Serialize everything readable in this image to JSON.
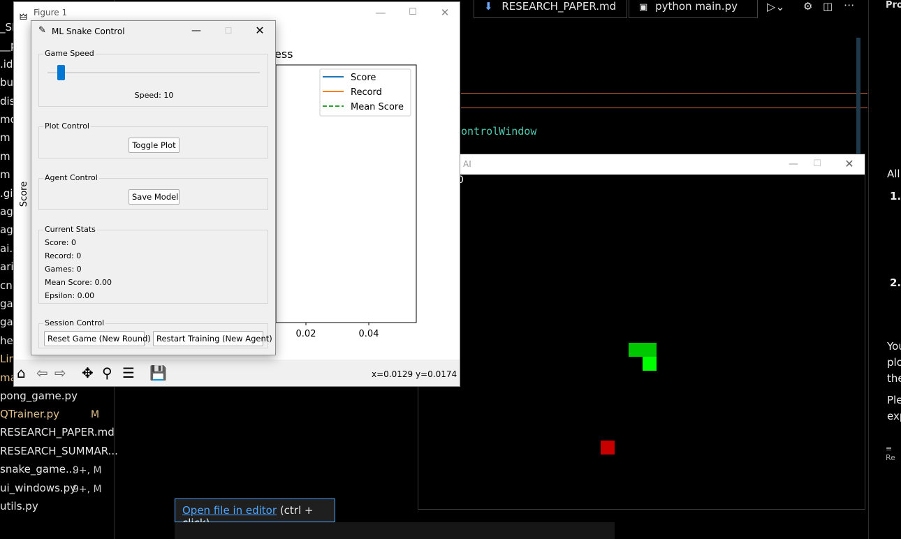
{
  "explorer": {
    "partial_items": [
      "_SN",
      "__p",
      ".ide",
      "bu",
      "dis",
      "mo",
      "m",
      "m",
      "m",
      ".git",
      "age",
      "age",
      "ai.i",
      "aria",
      "cnn",
      "ga",
      "ga",
      "hel",
      "Lin",
      "ma"
    ],
    "files": [
      {
        "name": "pong_game.py",
        "badge": ""
      },
      {
        "name": "QTrainer.py",
        "badge": "M"
      },
      {
        "name": "RESEARCH_PAPER.md",
        "badge": ""
      },
      {
        "name": "RESEARCH_SUMMAR...",
        "badge": ""
      },
      {
        "name": "snake_game....",
        "badge": "9+, M"
      },
      {
        "name": "ui_windows.py",
        "badge": "9+, M"
      },
      {
        "name": "utils.py",
        "badge": ""
      }
    ]
  },
  "tabs": [
    "RESEARCH_PAPER.md",
    "python main.py"
  ],
  "right_panel": {
    "title": "Pro",
    "text_all": "All",
    "item1": "1.",
    "item2": "2.",
    "para1": [
      "You",
      "plo",
      "the"
    ],
    "para2": [
      "Ple",
      "exp"
    ],
    "footer": "Re"
  },
  "editor": {
    "code_fragment": "ontrolWindow"
  },
  "figure": {
    "title": "Figure 1",
    "chart_title_fragment": "ess",
    "ylabel": "Score",
    "status": "x=0.0129 y=0.0174"
  },
  "chart_data": {
    "type": "line",
    "title": "",
    "xlabel": "",
    "ylabel": "Score",
    "x_ticks_visible": [
      "0.02",
      "0.04"
    ],
    "series": [
      {
        "name": "Score",
        "color": "#1f77b4",
        "style": "solid",
        "values": []
      },
      {
        "name": "Record",
        "color": "#ff7f0e",
        "style": "solid",
        "values": []
      },
      {
        "name": "Mean Score",
        "color": "#2ca02c",
        "style": "dashed",
        "values": []
      }
    ],
    "legend": "top-right"
  },
  "control": {
    "title": "ML Snake Control",
    "game_speed_label": "Game Speed",
    "speed_text": "Speed: 10",
    "speed_value": 10,
    "plot_control_label": "Plot Control",
    "toggle_plot": "Toggle Plot",
    "agent_control_label": "Agent Control",
    "save_model": "Save Model",
    "stats_label": "Current Stats",
    "stats": [
      "Score: 0",
      "Record: 0",
      "Games: 0",
      "Mean Score: 0.00",
      "Epsilon: 0.00"
    ],
    "session_label": "Session Control",
    "reset_game": "Reset Game (New Round)",
    "restart_training": "Restart Training (New Agent)"
  },
  "game": {
    "title_fragment": "AI",
    "score_fragment": "0"
  },
  "tooltip": {
    "link": "Open file in editor",
    "hint": "(ctrl + click)"
  },
  "colors": {
    "accent": "#0078d4",
    "snake_head": "#00ff00",
    "snake_body": "#00c800",
    "food": "#c80000"
  }
}
